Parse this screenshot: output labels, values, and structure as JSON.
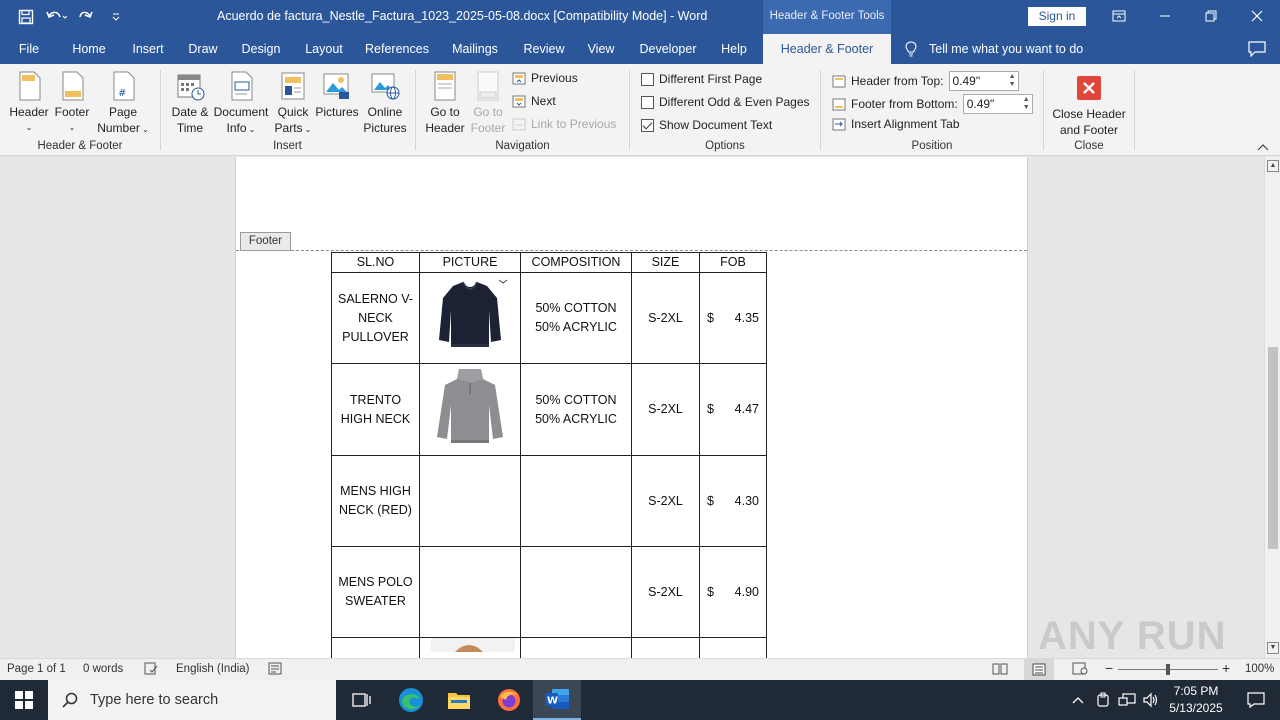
{
  "titlebar": {
    "title": "Acuerdo de factura_Nestle_Factura_1023_2025-05-08.docx [Compatibility Mode] - Word",
    "contextual_tab": "Header & Footer Tools",
    "sign_in": "Sign in"
  },
  "tabs": [
    "File",
    "Home",
    "Insert",
    "Draw",
    "Design",
    "Layout",
    "References",
    "Mailings",
    "Review",
    "View",
    "Developer",
    "Help",
    "Header & Footer"
  ],
  "active_tab": "Header & Footer",
  "tell_me": "Tell me what you want to do",
  "ribbon": {
    "group_hf": {
      "label": "Header & Footer",
      "header": "Header",
      "footer": "Footer",
      "page_number_1": "Page",
      "page_number_2": "Number"
    },
    "group_insert": {
      "label": "Insert",
      "date_time_1": "Date &",
      "date_time_2": "Time",
      "doc_info_1": "Document",
      "doc_info_2": "Info",
      "quick_parts_1": "Quick",
      "quick_parts_2": "Parts",
      "pictures": "Pictures",
      "online_pictures_1": "Online",
      "online_pictures_2": "Pictures"
    },
    "group_nav": {
      "label": "Navigation",
      "goto_header_1": "Go to",
      "goto_header_2": "Header",
      "goto_footer_1": "Go to",
      "goto_footer_2": "Footer",
      "previous": "Previous",
      "next": "Next",
      "link_previous": "Link to Previous"
    },
    "group_options": {
      "label": "Options",
      "diff_first": "Different First Page",
      "diff_odd_even": "Different Odd & Even Pages",
      "show_doc_text": "Show Document Text",
      "diff_first_checked": false,
      "diff_odd_even_checked": false,
      "show_doc_text_checked": true
    },
    "group_position": {
      "label": "Position",
      "header_from_top": "Header from Top:",
      "header_from_top_value": "0.49\"",
      "footer_from_bottom": "Footer from Bottom:",
      "footer_from_bottom_value": "0.49\"",
      "insert_alignment_tab": "Insert Alignment Tab"
    },
    "group_close": {
      "label": "Close",
      "close_1": "Close Header",
      "close_2": "and Footer"
    }
  },
  "document": {
    "footer_tag": "Footer",
    "table_headers": [
      "SL.NO",
      "PICTURE",
      "COMPOSITION",
      "SIZE",
      "FOB"
    ],
    "rows": [
      {
        "name_1": "SALERNO V-",
        "name_2": "NECK",
        "name_3": "PULLOVER",
        "composition_1": "50% COTTON",
        "composition_2": "50% ACRYLIC",
        "size": "S-2XL",
        "currency": "$",
        "fob": "4.35",
        "picture": "navy-sweater"
      },
      {
        "name_1": "TRENTO",
        "name_2": "HIGH NECK",
        "name_3": "",
        "composition_1": "50% COTTON",
        "composition_2": "50% ACRYLIC",
        "size": "S-2XL",
        "currency": "$",
        "fob": "4.47",
        "picture": "grey-sweater"
      },
      {
        "name_1": "MENS HIGH",
        "name_2": "NECK (RED)",
        "name_3": "",
        "composition_1": "",
        "composition_2": "",
        "size": "S-2XL",
        "currency": "$",
        "fob": "4.30",
        "picture": ""
      },
      {
        "name_1": "MENS POLO",
        "name_2": "SWEATER",
        "name_3": "",
        "composition_1": "",
        "composition_2": "",
        "size": "S-2XL",
        "currency": "$",
        "fob": "4.90",
        "picture": ""
      }
    ]
  },
  "statusbar": {
    "page": "Page 1 of 1",
    "words": "0 words",
    "language": "English (India)",
    "zoom": "100%"
  },
  "taskbar": {
    "search_placeholder": "Type here to search",
    "time": "7:05 PM",
    "date": "5/13/2025"
  },
  "watermark": "ANY RUN",
  "colors": {
    "word_blue": "#2b579a",
    "close_red": "#e0463a"
  }
}
